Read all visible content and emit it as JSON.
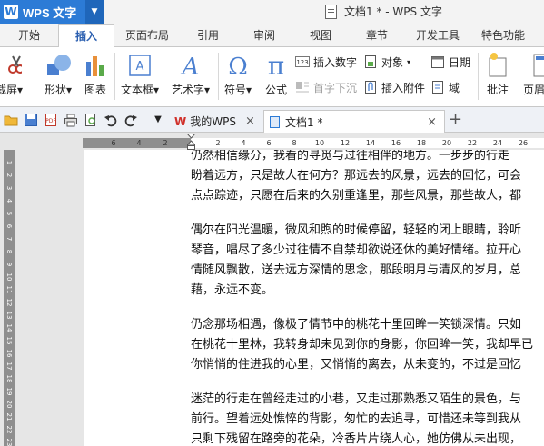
{
  "app": {
    "name": "WPS 文字",
    "logo_letter": "W",
    "window_title": "文档1 * - WPS 文字"
  },
  "ribbon_tabs": [
    {
      "label": "开始",
      "active": false
    },
    {
      "label": "插入",
      "active": true
    },
    {
      "label": "页面布局",
      "active": false
    },
    {
      "label": "引用",
      "active": false
    },
    {
      "label": "审阅",
      "active": false
    },
    {
      "label": "视图",
      "active": false
    },
    {
      "label": "章节",
      "active": false
    },
    {
      "label": "开发工具",
      "active": false
    },
    {
      "label": "特色功能",
      "active": false
    }
  ],
  "ribbon": {
    "screenshot": "截屏",
    "shapes": "形状",
    "chart": "图表",
    "textbox": "文本框",
    "wordart": "艺术字",
    "symbol": "符号",
    "formula": "公式",
    "insert_number": "插入数字",
    "object": "对象",
    "date": "日期",
    "drop_cap": "首字下沉",
    "insert_attachment": "插入附件",
    "field": "域",
    "comment": "批注",
    "page_cut": "页眉"
  },
  "doc_tabs": [
    {
      "label": "我的WPS",
      "active": false
    },
    {
      "label": "文档1 *",
      "active": true
    }
  ],
  "ruler": {
    "h_numbers": [
      "6",
      "4",
      "2",
      "2",
      "4",
      "6",
      "8",
      "10",
      "12",
      "14",
      "16",
      "18",
      "20",
      "22",
      "24",
      "26"
    ],
    "v_numbers": [
      "1",
      "2",
      "3",
      "4",
      "5",
      "6",
      "7",
      "8",
      "9",
      "10",
      "11",
      "12",
      "13",
      "14",
      "15",
      "16",
      "17",
      "18",
      "19",
      "20",
      "21",
      "22",
      "23"
    ]
  },
  "document": {
    "paragraphs": [
      {
        "lines": [
          "仍然相信缘分，我看的寻觅与过往相伴的地方。一步步的行走",
          "盼着远方，只是故人在何方？那远去的风景，远去的回忆，可会",
          "点点踪迹，只愿在后来的久别重逢里，那些风景，那些故人，都"
        ]
      },
      {
        "lines": [
          "偶尔在阳光温暖，微风和煦的时候停留，轻轻的闭上眼睛，聆听",
          "琴音，唱尽了多少过往情不自禁却欲说还休的美好情绪。拉开心",
          "情随风飘散，送去远方深情的思念，那段明月与清风的岁月，总",
          "藉，永远不变。"
        ]
      },
      {
        "lines": [
          "仍念那场相遇，像极了情节中的桃花十里回眸一笑锁深情。只如",
          "在桃花十里林，我转身却未见到你的身影，你回眸一笑，我却早已",
          "你悄悄的住进我的心里，又悄悄的离去，从未变的，不过是回忆"
        ]
      },
      {
        "lines": [
          "迷茫的行走在曾经走过的小巷，又走过那熟悉又陌生的景色，与",
          "前行。望着远处憔悴的背影，匆忙的去追寻，可惜还未等到我从",
          "只剩下残留在路旁的花朵，冷香片片绕人心，她仿佛从未出现，"
        ]
      }
    ]
  },
  "colors": {
    "brand_blue": "#2c7bd6",
    "active_tab_text": "#2b5fb0",
    "ruler_gray": "#8f8f8f"
  }
}
